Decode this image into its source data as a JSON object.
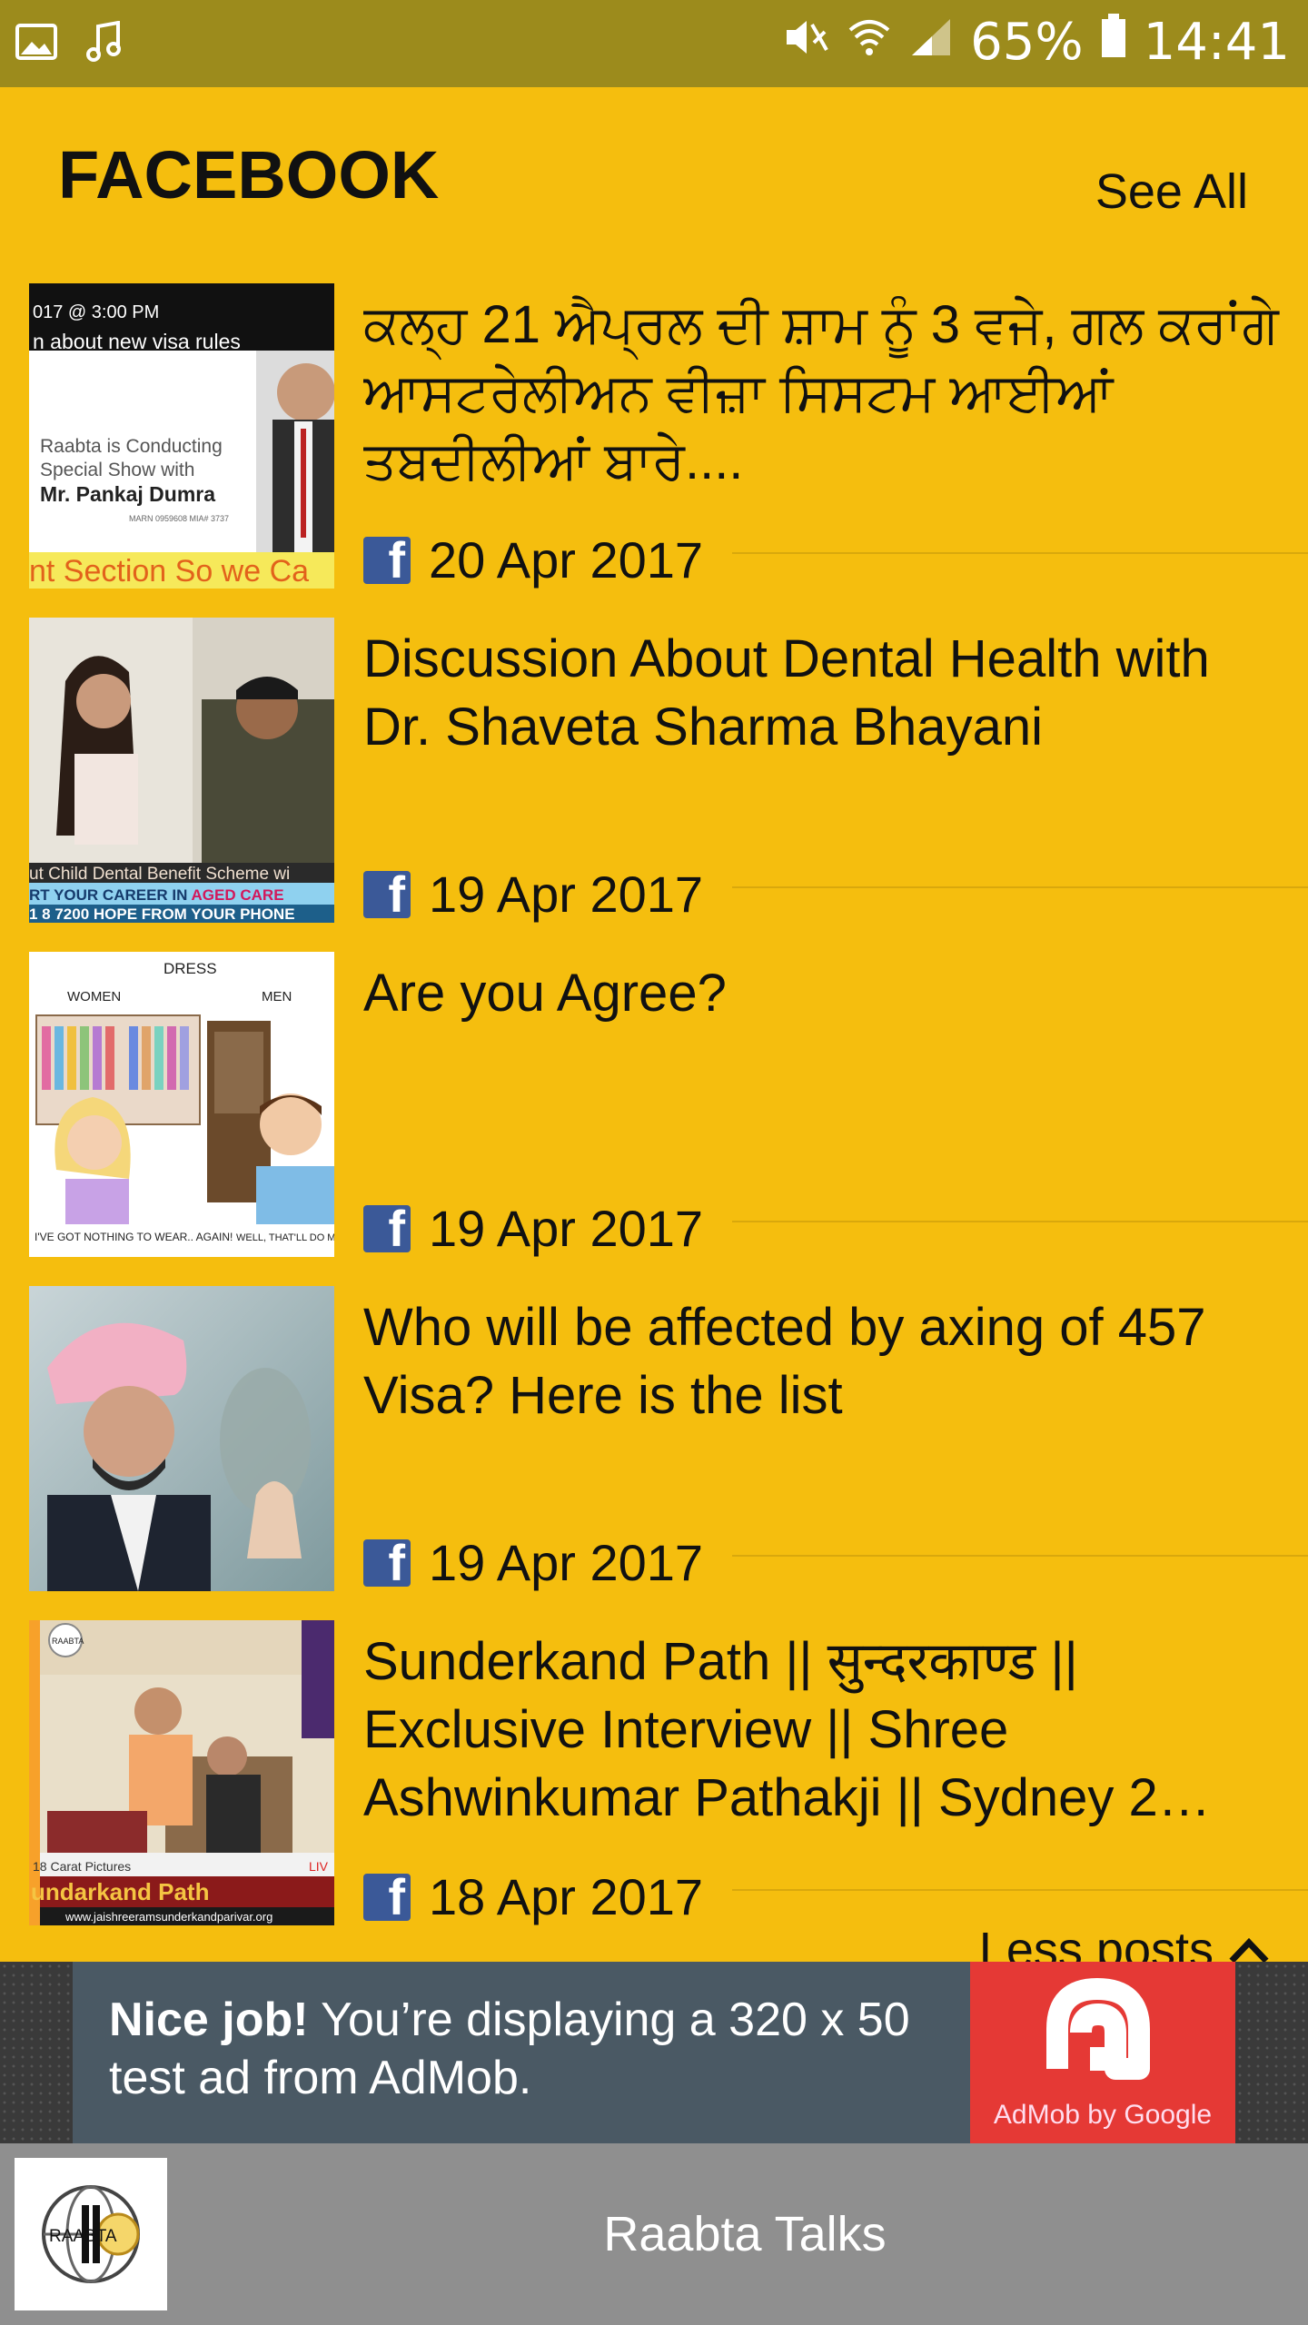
{
  "status_bar": {
    "battery": "65%",
    "time": "14:41",
    "icons": [
      "image-icon",
      "music-note-icon",
      "mute-icon",
      "wifi-icon",
      "signal-icon",
      "battery-icon"
    ]
  },
  "section": {
    "title": "FACEBOOK",
    "see_all_label": "See All"
  },
  "posts": [
    {
      "title": "ਕਲ੍ਹ 21 ਐਪ੍ਰਲ ਦੀ ਸ਼ਾਮ ਨੂੰ 3 ਵਜੇ, ਗਲ ਕਰਾਂਗੇ ਆਸਟਰੇਲੀਅਨ ਵੀਜ਼ਾ ਸਿਸਟਮ ਆਈਆਂ ਤਬਦੀਲੀਆਂ ਬਾਰੇ....",
      "date": "20 Apr 2017",
      "thumb": {
        "top_text": "017 @ 3:00 PM",
        "line2": "n about new visa rules",
        "body1": "Raabta is Conducting",
        "body2": "Special Show with",
        "name": "Mr. Pankaj Dumra",
        "small": "MARN 0959608 MIA# 3737",
        "bottom": "nt Section So we Ca"
      }
    },
    {
      "title": "Discussion About Dental Health with Dr. Shaveta Sharma Bhayani",
      "date": "19 Apr 2017",
      "thumb": {
        "caption1": "ut Child Dental Benefit Scheme wi",
        "caption2a": "RT YOUR CAREER IN ",
        "caption2b": "AGED CARE",
        "caption3": "1 8 7200 HOPE FROM YOUR PHONE"
      }
    },
    {
      "title": "Are you Agree?",
      "date": "19 Apr 2017",
      "thumb": {
        "heading": "DRESS",
        "left_label": "WOMEN",
        "right_label": "MEN",
        "left_quote": "I'VE GOT NOTHING TO WEAR.. AGAIN!",
        "right_quote": "WELL, THAT'LL DO ME FOR A WEEK!"
      }
    },
    {
      "title": "Who will be affected by axing of 457 Visa? Here is the list",
      "date": "19 Apr 2017",
      "thumb": {}
    },
    {
      "title": "Sunderkand Path || सुन्दरकाण्ड || Exclusive Interview || Shree Ashwinkumar Pathakji || Sydney 2…",
      "date": "18 Apr 2017",
      "thumb": {
        "badge": "RAABTA",
        "label": "18 Carat Pictures",
        "banner": "undarkand Path",
        "live": "LIV",
        "url": "www.jaishreeramsunderkandparivar.org"
      }
    }
  ],
  "less_posts_label": "Less posts",
  "ad": {
    "bold": "Nice job!",
    "text": " You’re displaying a 320 x 50 test ad from AdMob.",
    "brand": "AdMob by Google"
  },
  "bottom_bar": {
    "title": "Raabta Talks",
    "logo_text": "RAABTA"
  },
  "colors": {
    "background": "#F5BE0E",
    "status_bar": "#9C8B1C",
    "facebook": "#3B5998",
    "ad_panel": "#4A5964",
    "ad_brand": "#E53935",
    "bottom_bar": "#8F8F8F"
  }
}
